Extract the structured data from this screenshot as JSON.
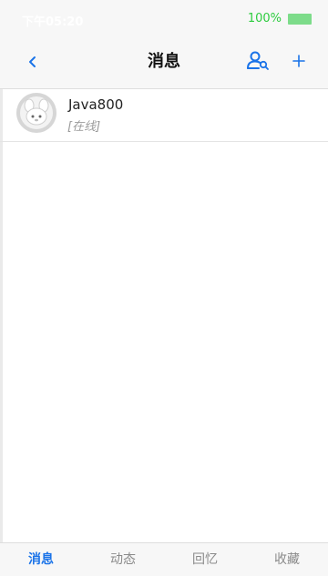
{
  "status_bar": {
    "time": "下午05:20",
    "battery_percent": "100%",
    "battery_color": "#7ddc8a"
  },
  "nav": {
    "back_icon": "chevron-left-icon",
    "title": "消息",
    "contacts_icon": "contacts-icon",
    "add_icon": "plus-icon"
  },
  "messages": [
    {
      "name": "Java800",
      "status": "[在线]",
      "avatar_icon": "avatar-icon"
    }
  ],
  "tabs": [
    {
      "label": "消息",
      "active": true
    },
    {
      "label": "动态",
      "active": false
    },
    {
      "label": "回忆",
      "active": false
    },
    {
      "label": "收藏",
      "active": false
    }
  ],
  "colors": {
    "accent": "#1a73e8",
    "online_green": "#2ecc40",
    "header_bg": "#f7f7f7"
  }
}
